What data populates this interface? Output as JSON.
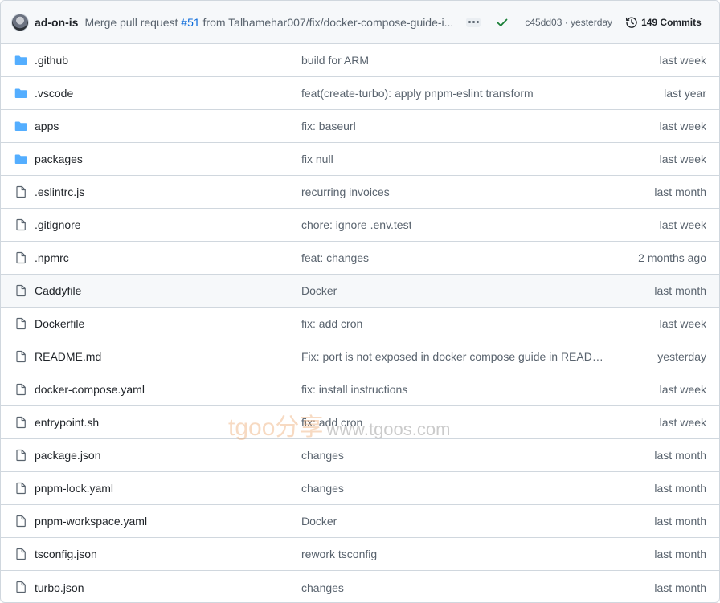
{
  "commit": {
    "author": "ad-on-is",
    "message_prefix": "Merge pull request ",
    "pr_number": "#51",
    "message_suffix": " from Talhamehar007/fix/docker-compose-guide-i...",
    "sha_time": "c45dd03 · yesterday",
    "commits_count": "149 Commits",
    "status": "success"
  },
  "icons": {
    "folder": "folder-icon",
    "file": "file-icon",
    "check": "check-icon",
    "history": "history-icon",
    "ellipsis": "ellipsis-icon"
  },
  "colors": {
    "folder": "#54aeff",
    "link": "#0969da",
    "success": "#1a7f37",
    "muted": "#59636e"
  },
  "files": [
    {
      "type": "folder",
      "name": ".github",
      "message": "build for ARM",
      "date": "last week"
    },
    {
      "type": "folder",
      "name": ".vscode",
      "message": "feat(create-turbo): apply pnpm-eslint transform",
      "date": "last year"
    },
    {
      "type": "folder",
      "name": "apps",
      "message": "fix: baseurl",
      "date": "last week"
    },
    {
      "type": "folder",
      "name": "packages",
      "message": "fix null",
      "date": "last week"
    },
    {
      "type": "file",
      "name": ".eslintrc.js",
      "message": "recurring invoices",
      "date": "last month"
    },
    {
      "type": "file",
      "name": ".gitignore",
      "message": "chore: ignore .env.test",
      "date": "last week"
    },
    {
      "type": "file",
      "name": ".npmrc",
      "message": "feat: changes",
      "date": "2 months ago"
    },
    {
      "type": "file",
      "name": "Caddyfile",
      "message": "Docker",
      "date": "last month",
      "hover": true
    },
    {
      "type": "file",
      "name": "Dockerfile",
      "message": "fix: add cron",
      "date": "last week"
    },
    {
      "type": "file",
      "name": "README.md",
      "message": "Fix: port is not exposed in docker compose guide in READM...",
      "date": "yesterday"
    },
    {
      "type": "file",
      "name": "docker-compose.yaml",
      "message": "fix: install instructions",
      "date": "last week"
    },
    {
      "type": "file",
      "name": "entrypoint.sh",
      "message": "fix: add cron",
      "date": "last week"
    },
    {
      "type": "file",
      "name": "package.json",
      "message": "changes",
      "date": "last month"
    },
    {
      "type": "file",
      "name": "pnpm-lock.yaml",
      "message": "changes",
      "date": "last month"
    },
    {
      "type": "file",
      "name": "pnpm-workspace.yaml",
      "message": "Docker",
      "date": "last month"
    },
    {
      "type": "file",
      "name": "tsconfig.json",
      "message": "rework tsconfig",
      "date": "last month"
    },
    {
      "type": "file",
      "name": "turbo.json",
      "message": "changes",
      "date": "last month"
    }
  ],
  "watermark": {
    "brand": "tgoo分享",
    "url": "www.tgoos.com"
  }
}
